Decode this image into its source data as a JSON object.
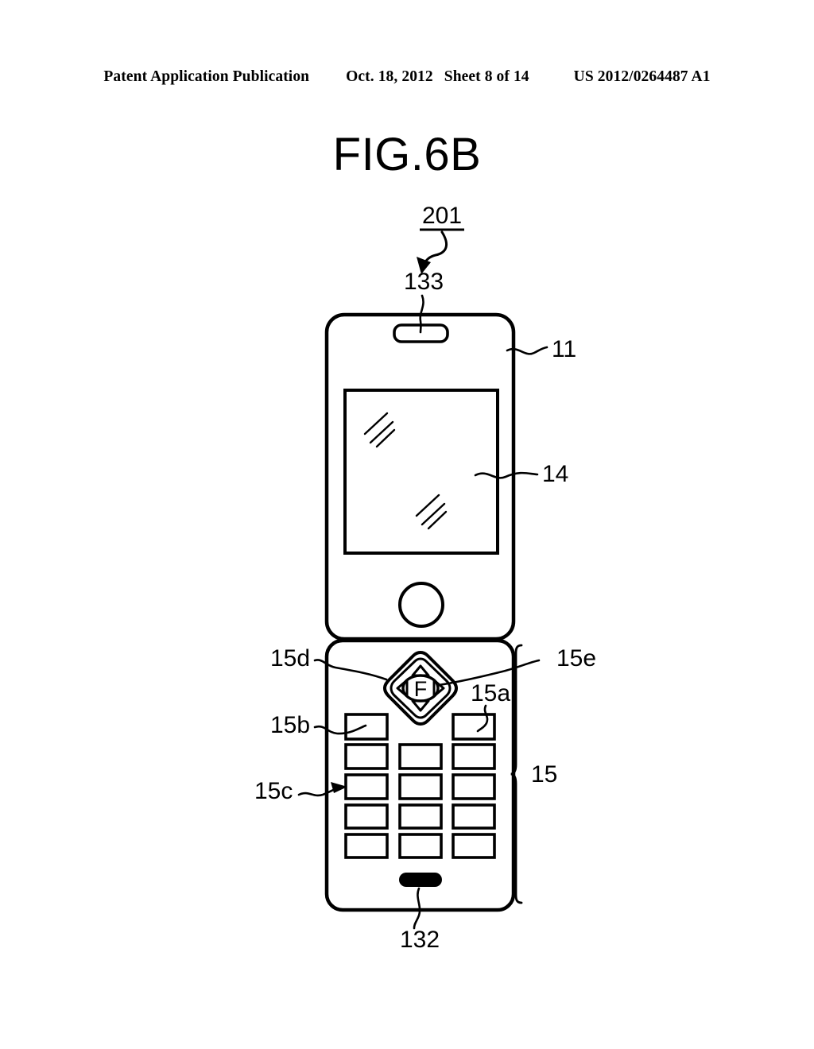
{
  "header": {
    "publication": "Patent Application Publication",
    "date": "Oct. 18, 2012",
    "sheet": "Sheet 8 of 14",
    "patent_number": "US 2012/0264487 A1"
  },
  "figure": {
    "title": "FIG.6B",
    "assembly_label": "201"
  },
  "labels": {
    "speaker": "133",
    "housing": "11",
    "display": "14",
    "key_15a": "15a",
    "key_15b": "15b",
    "key_15c": "15c",
    "nav_15d": "15d",
    "center_15e": "15e",
    "keypad_group": "15",
    "microphone": "132",
    "nav_center_glyph": "F"
  },
  "colors": {
    "ink": "#000000",
    "paper": "#ffffff"
  },
  "keypad": {
    "rows": 5,
    "columns": 3,
    "first_row_has_middle_key": false
  }
}
